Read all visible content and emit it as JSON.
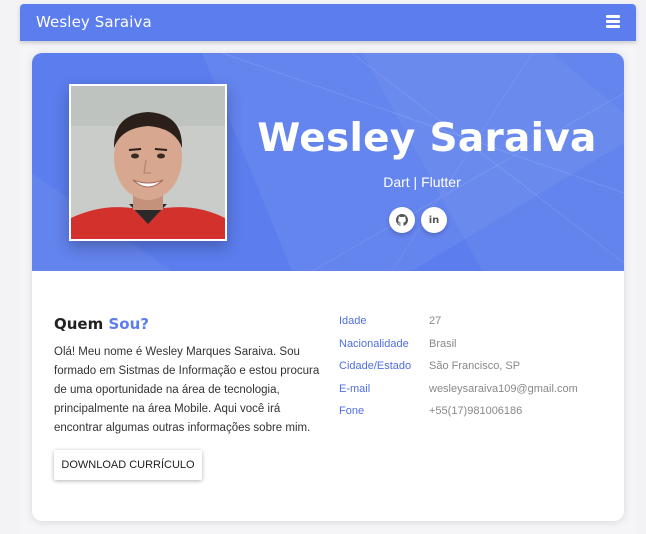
{
  "navbar": {
    "brand": "Wesley Saraiva",
    "menu_icon": "hamburger-menu-icon"
  },
  "colors": {
    "accent": "#5b7ded",
    "label": "#4f6ee0",
    "value": "#888888"
  },
  "hero": {
    "name": "Wesley Saraiva",
    "subtitle": "Dart | Flutter",
    "social": [
      {
        "name": "github",
        "icon": "github-icon"
      },
      {
        "name": "linkedin",
        "icon": "linkedin-icon",
        "text": "in"
      }
    ]
  },
  "about": {
    "title_prefix": "Quem",
    "title_accent": "Sou?",
    "lines": [
      "Olá! Meu nome é Wesley Marques Saraiva. Sou",
      "formado em Sistmas de Informação e estou procura",
      "de uma oportunidade na área de tecnologia,",
      "principalmente na área Mobile. Aqui você irá",
      "encontrar algumas outras informações sobre mim."
    ],
    "download_label": "DOWNLOAD CURRÍCULO"
  },
  "info": [
    {
      "label": "Idade",
      "value": "27"
    },
    {
      "label": "Nacionalidade",
      "value": "Brasil"
    },
    {
      "label": "Cidade/Estado",
      "value": "São Francisco, SP"
    },
    {
      "label": "E-mail",
      "value": "wesleysaraiva109@gmail.com"
    },
    {
      "label": "Fone",
      "value": "+55(17)981006186"
    }
  ]
}
